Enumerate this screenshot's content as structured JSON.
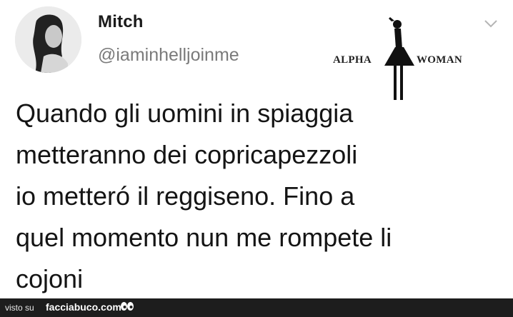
{
  "tweet": {
    "author_name": "Mitch",
    "handle": "@iaminhelljoinme",
    "lines": [
      "Quando gli uomini in spiaggia",
      "metteranno dei copricapezzoli",
      "io metteró il reggiseno. Fino a",
      "quel momento nun me rompete li",
      "cojoni"
    ]
  },
  "watermark": {
    "left_text": "ALPHA",
    "right_text": "WOMAN"
  },
  "footer": {
    "prefix": "visto su",
    "site": "facciabuco.com"
  },
  "icons": {
    "menu": "chevron-down-icon",
    "logo": "woman-silhouette-icon",
    "eyes": "eyes-icon"
  }
}
